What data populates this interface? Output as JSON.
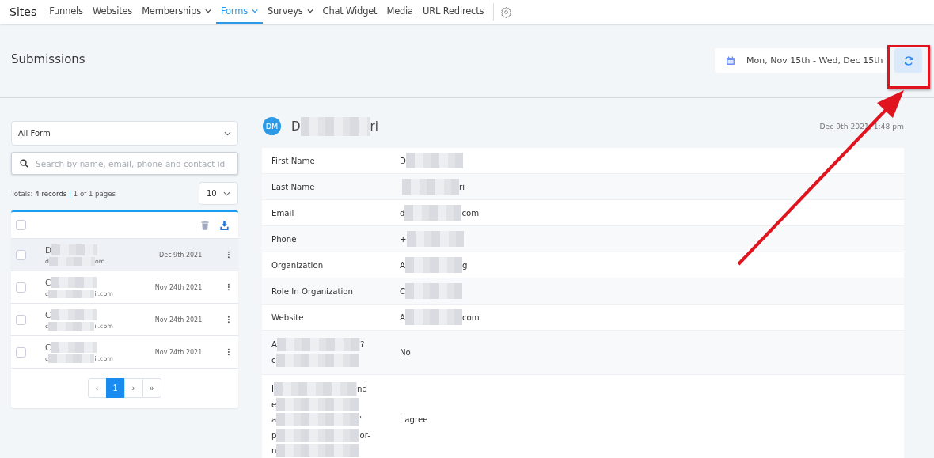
{
  "nav": {
    "brand": "Sites",
    "items": [
      {
        "label": "Funnels",
        "dropdown": false,
        "selected": false
      },
      {
        "label": "Websites",
        "dropdown": false,
        "selected": false
      },
      {
        "label": "Memberships",
        "dropdown": true,
        "selected": false
      },
      {
        "label": "Forms",
        "dropdown": true,
        "selected": true
      },
      {
        "label": "Surveys",
        "dropdown": true,
        "selected": false
      },
      {
        "label": "Chat Widget",
        "dropdown": false,
        "selected": false
      },
      {
        "label": "Media",
        "dropdown": false,
        "selected": false
      },
      {
        "label": "URL Redirects",
        "dropdown": false,
        "selected": false
      }
    ]
  },
  "header": {
    "title": "Submissions",
    "date_range": "Mon, Nov 15th - Wed, Dec 15th"
  },
  "filters": {
    "form_select": "All Form",
    "search": {
      "placeholder": "Search by name, email, phone and contact id"
    },
    "totals_prefix": "Totals: ",
    "totals_count": "4 records",
    "totals_sep": " | ",
    "totals_pages": "1 of 1 pages",
    "page_size": "10"
  },
  "list": {
    "select_all": false,
    "rows": [
      {
        "name": "D",
        "email_start": "d",
        "email_end": "om",
        "date": "Dec 9th 2021",
        "selected": true,
        "checked": false
      },
      {
        "name": "C",
        "email_start": "c",
        "email_end": "il.com",
        "date": "Nov 24th 2021",
        "selected": false,
        "checked": false
      },
      {
        "name": "C",
        "email_start": "c",
        "email_end": "il.com",
        "date": "Nov 24th 2021",
        "selected": false,
        "checked": false
      },
      {
        "name": "C",
        "email_start": "c",
        "email_end": "il.com",
        "date": "Nov 24th 2021",
        "selected": false,
        "checked": false
      }
    ],
    "pagination": {
      "prev": "‹",
      "pages": [
        {
          "label": "1",
          "selected": true
        }
      ],
      "next": "›",
      "last": "»"
    }
  },
  "detail": {
    "initials": "DM",
    "name_start": "D",
    "name_end": "ri",
    "timestamp": "Dec 9th 2021, 1:48 pm",
    "fields": [
      {
        "label": [
          {
            "start": "First Name"
          }
        ],
        "value": {
          "start": "D",
          "redacted": true
        }
      },
      {
        "label": [
          {
            "start": "Last Name"
          }
        ],
        "value": {
          "start": "I",
          "end": "ri",
          "redacted": true
        }
      },
      {
        "label": [
          {
            "start": "Email"
          }
        ],
        "value": {
          "start": "d",
          "end": "com",
          "redacted": true
        }
      },
      {
        "label": [
          {
            "start": "Phone"
          }
        ],
        "value": {
          "start": "+",
          "redacted": true
        }
      },
      {
        "label": [
          {
            "start": "Organization"
          }
        ],
        "value": {
          "start": "A",
          "end": "g",
          "redacted": true
        }
      },
      {
        "label": [
          {
            "start": "Role In Organization"
          }
        ],
        "value": {
          "start": "C",
          "redacted": true
        }
      },
      {
        "label": [
          {
            "start": "Website"
          }
        ],
        "value": {
          "start": "A",
          "end": "com",
          "redacted": true
        }
      },
      {
        "label": [
          {
            "start": "A",
            "end": "?",
            "redacted": true
          },
          {
            "start": "c",
            "redacted": true
          }
        ],
        "value": {
          "start": "No",
          "redacted": false
        }
      },
      {
        "label": [
          {
            "start": "I",
            "end": "nd",
            "redacted": true
          },
          {
            "start": "e",
            "redacted": true
          },
          {
            "start": "a",
            "end": "'",
            "redacted": true
          },
          {
            "start": "p",
            "end": "or-",
            "redacted": true
          },
          {
            "start": "n",
            "redacted": true
          }
        ],
        "value": {
          "start": "I agree",
          "redacted": false
        }
      }
    ]
  },
  "annotations": [
    {
      "kind": "box"
    },
    {
      "kind": "arrow"
    }
  ]
}
